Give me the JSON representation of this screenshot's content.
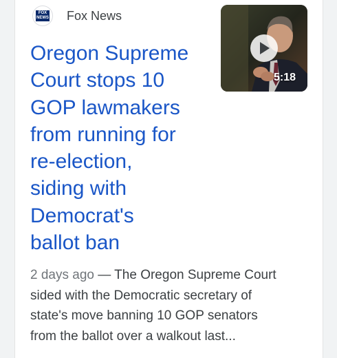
{
  "article": {
    "source": "Fox News",
    "source_logo_text": "FOX NEWS",
    "headline_lines": [
      "Oregon Supreme",
      "Court stops 10",
      "GOP lawmakers",
      "from running for",
      "re-election,",
      "siding with",
      "Democrat's",
      "ballot ban"
    ],
    "video_duration": "5:18",
    "snippet_date": "2 days ago",
    "snippet_lines": [
      "— The Oregon Supreme Court",
      "sided with the Democratic secretary of",
      "state's move banning 10 GOP senators",
      "from the ballot over a walkout last..."
    ]
  },
  "colors": {
    "headline": "#1a56c7",
    "snippet_text": "#3c4043",
    "date_text": "#70757a",
    "fox_blue": "#0b2a6b"
  },
  "icons": {
    "play": "play-icon",
    "logo": "fox-news-logo"
  }
}
